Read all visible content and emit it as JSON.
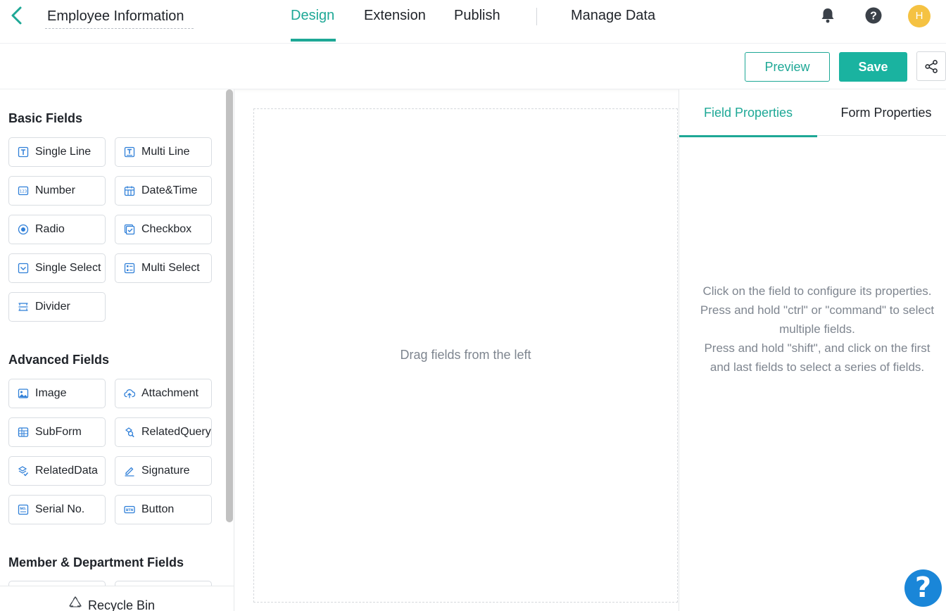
{
  "header": {
    "app_title": "Employee Information",
    "nav": [
      {
        "label": "Design",
        "active": true
      },
      {
        "label": "Extension",
        "active": false
      },
      {
        "label": "Publish",
        "active": false
      },
      {
        "label": "Manage Data",
        "active": false
      }
    ],
    "avatar_initial": "H",
    "icons": [
      "back-arrow-icon",
      "bell-icon",
      "help-icon"
    ]
  },
  "toolbar": {
    "preview_label": "Preview",
    "save_label": "Save",
    "share_icon": "share-icon"
  },
  "left_panel": {
    "sections": [
      {
        "title": "Basic Fields",
        "fields": [
          {
            "label": "Single Line",
            "icon": "single-line-icon"
          },
          {
            "label": "Multi Line",
            "icon": "multi-line-icon"
          },
          {
            "label": "Number",
            "icon": "number-icon"
          },
          {
            "label": "Date&Time",
            "icon": "calendar-icon"
          },
          {
            "label": "Radio",
            "icon": "radio-icon"
          },
          {
            "label": "Checkbox",
            "icon": "checkbox-icon"
          },
          {
            "label": "Single Select",
            "icon": "single-select-icon"
          },
          {
            "label": "Multi Select",
            "icon": "multi-select-icon"
          },
          {
            "label": "Divider",
            "icon": "divider-icon"
          }
        ]
      },
      {
        "title": "Advanced Fields",
        "fields": [
          {
            "label": "Image",
            "icon": "image-icon"
          },
          {
            "label": "Attachment",
            "icon": "upload-icon"
          },
          {
            "label": "SubForm",
            "icon": "subform-icon"
          },
          {
            "label": "RelatedQuery",
            "icon": "related-query-icon"
          },
          {
            "label": "RelatedData",
            "icon": "related-data-icon"
          },
          {
            "label": "Signature",
            "icon": "pen-icon"
          },
          {
            "label": "Serial No.",
            "icon": "serial-number-icon"
          },
          {
            "label": "Button",
            "icon": "button-icon"
          }
        ]
      },
      {
        "title": "Member & Department Fields",
        "fields": []
      }
    ],
    "recycle_bin_label": "Recycle Bin"
  },
  "canvas": {
    "hint": "Drag fields from the left"
  },
  "right_panel": {
    "tabs": [
      {
        "label": "Field Properties",
        "active": true
      },
      {
        "label": "Form Properties",
        "active": false
      }
    ],
    "hint_lines": [
      "Click on the field to configure its properties.",
      "Press and hold \"ctrl\" or \"command\" to select",
      "multiple fields.",
      "Press and hold \"shift\", and click on the first",
      "and last fields to select a series of fields."
    ]
  },
  "help_fab": "?",
  "colors": {
    "accent": "#1ea896",
    "save_bg": "#1ab3a0",
    "field_icon": "#2f7fd8",
    "avatar_bg": "#f5c242",
    "help_fab_bg": "#1a86d8"
  }
}
